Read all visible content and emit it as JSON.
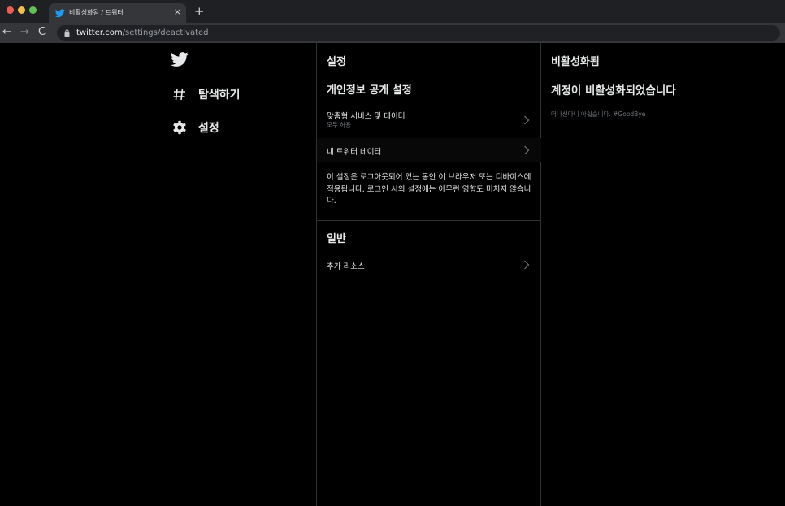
{
  "browser": {
    "tab_title": "비활성화됨 / 트위터",
    "tab_close": "×",
    "new_tab": "+",
    "url_host": "twitter.com",
    "url_path": "/settings/deactivated",
    "nav_back": "←",
    "nav_forward": "→",
    "nav_reload": "C"
  },
  "leftnav": {
    "items": [
      {
        "label": "탐색하기",
        "icon": "hashtag-icon"
      },
      {
        "label": "설정",
        "icon": "gear-icon"
      }
    ]
  },
  "middle": {
    "title": "설정",
    "privacy_section": "개인정보 공개 설정",
    "personalization_label": "맞춤형 서비스 및 데이터",
    "personalization_sub": "모두 허용",
    "my_data_label": "내 트위터 데이터",
    "note": "이 설정은 로그아웃되어 있는 동안 이 브라우저 또는 디바이스에 적용됩니다. 로그인 시의 설정에는 아무런 영향도 미치지 않습니다.",
    "general_section": "일반",
    "extra_resources_label": "추가 리소스"
  },
  "right": {
    "title": "비활성화됨",
    "heading": "계정이 비활성화되었습니다",
    "goodbye": "떠나신다니 아쉽습니다. #GoodBye"
  },
  "colors": {
    "twitter_blue": "#1d9bf0",
    "background": "#000000",
    "border": "#2f3336"
  }
}
